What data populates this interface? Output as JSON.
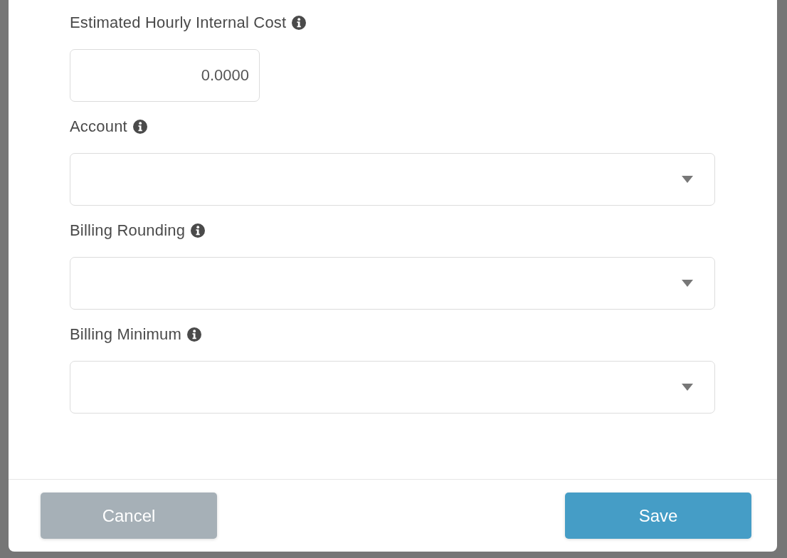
{
  "form": {
    "fields": [
      {
        "label": "Estimated Hourly Internal Cost",
        "kind": "number",
        "value": "0.0000"
      },
      {
        "label": "Account",
        "kind": "select"
      },
      {
        "label": "Billing Rounding",
        "kind": "select"
      },
      {
        "label": "Billing Minimum",
        "kind": "select"
      }
    ]
  },
  "buttons": [
    {
      "label": "Cancel",
      "kind": "secondary"
    },
    {
      "label": "Save",
      "kind": "primary"
    }
  ]
}
